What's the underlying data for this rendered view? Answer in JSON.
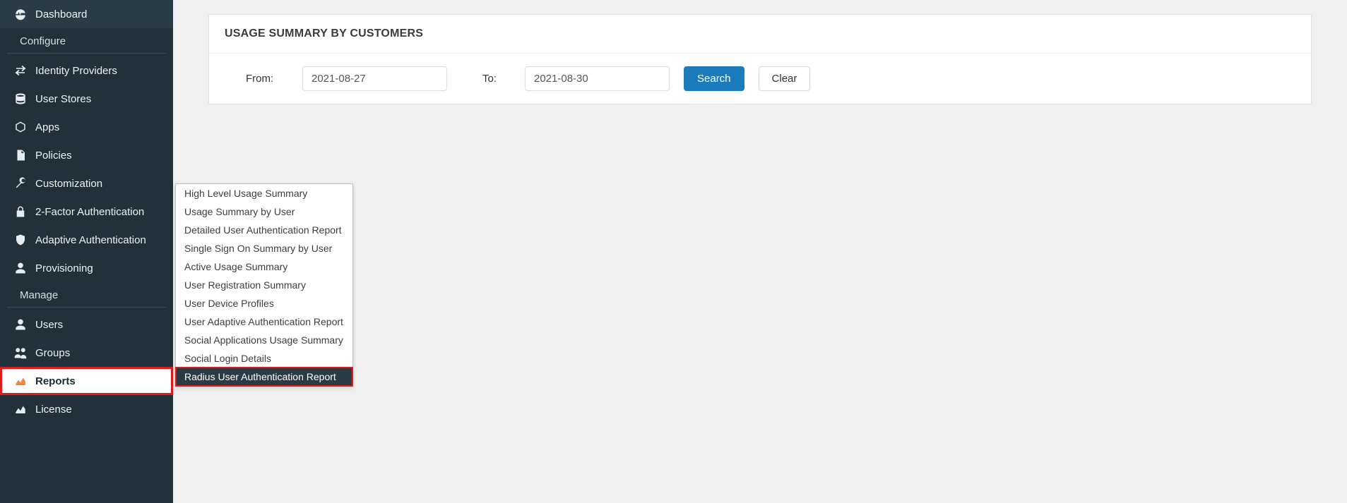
{
  "sidebar": {
    "items": [
      {
        "label": "Dashboard",
        "icon": "dashboard-icon"
      }
    ],
    "configure_header": "Configure",
    "configure_items": [
      {
        "label": "Identity Providers",
        "icon": "exchange-icon"
      },
      {
        "label": "User Stores",
        "icon": "database-icon"
      },
      {
        "label": "Apps",
        "icon": "cube-icon"
      },
      {
        "label": "Policies",
        "icon": "document-icon"
      },
      {
        "label": "Customization",
        "icon": "wrench-icon"
      },
      {
        "label": "2-Factor Authentication",
        "icon": "lock-icon"
      },
      {
        "label": "Adaptive Authentication",
        "icon": "shield-icon"
      },
      {
        "label": "Provisioning",
        "icon": "user-icon"
      }
    ],
    "manage_header": "Manage",
    "manage_items": [
      {
        "label": "Users",
        "icon": "user-icon"
      },
      {
        "label": "Groups",
        "icon": "users-icon"
      },
      {
        "label": "Reports",
        "icon": "area-chart-icon",
        "active": true
      },
      {
        "label": "License",
        "icon": "area-chart-icon"
      }
    ]
  },
  "panel": {
    "title": "USAGE SUMMARY BY CUSTOMERS",
    "from_label": "From:",
    "from_value": "2021-08-27",
    "to_label": "To:",
    "to_value": "2021-08-30",
    "search_label": "Search",
    "clear_label": "Clear"
  },
  "submenu": {
    "items": [
      "High Level Usage Summary",
      "Usage Summary by User",
      "Detailed User Authentication Report",
      "Single Sign On Summary by User",
      "Active Usage Summary",
      "User Registration Summary",
      "User Device Profiles",
      "User Adaptive Authentication Report",
      "Social Applications Usage Summary",
      "Social Login Details",
      "Radius User Authentication Report"
    ],
    "selected_index": 10
  }
}
